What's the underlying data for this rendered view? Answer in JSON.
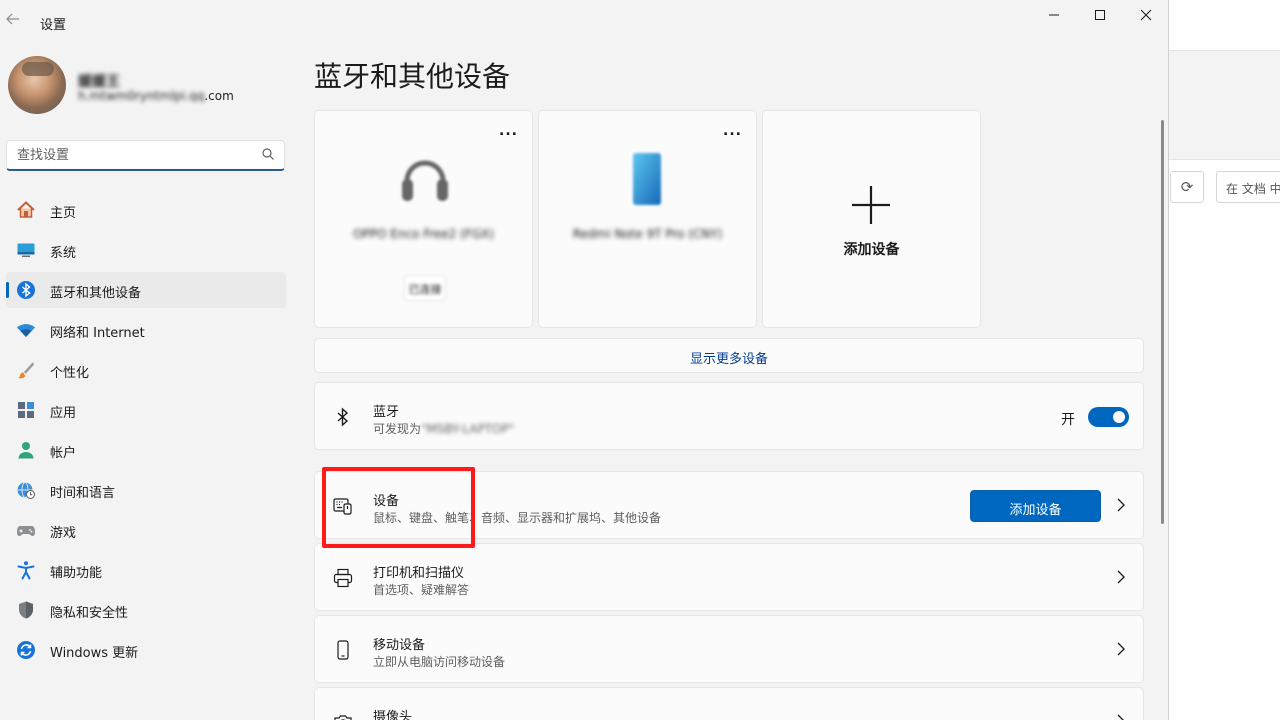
{
  "window": {
    "title": "设置"
  },
  "background_window": {
    "search_text": "在 文档 中"
  },
  "user": {
    "name": "媛媛王",
    "email_blurred": "h.mtwm0ryntmlpi.qq",
    "email_suffix": ".com"
  },
  "search": {
    "placeholder": "查找设置"
  },
  "nav": [
    {
      "label": "主页",
      "icon": "home-icon"
    },
    {
      "label": "系统",
      "icon": "monitor-icon"
    },
    {
      "label": "蓝牙和其他设备",
      "icon": "bluetooth-icon",
      "active": true
    },
    {
      "label": "网络和 Internet",
      "icon": "wifi-icon"
    },
    {
      "label": "个性化",
      "icon": "brush-icon"
    },
    {
      "label": "应用",
      "icon": "apps-icon"
    },
    {
      "label": "帐户",
      "icon": "person-icon"
    },
    {
      "label": "时间和语言",
      "icon": "globe-clock-icon"
    },
    {
      "label": "游戏",
      "icon": "gamepad-icon"
    },
    {
      "label": "辅助功能",
      "icon": "accessibility-icon"
    },
    {
      "label": "隐私和安全性",
      "icon": "shield-icon"
    },
    {
      "label": "Windows 更新",
      "icon": "update-icon"
    }
  ],
  "page": {
    "title": "蓝牙和其他设备"
  },
  "device_cards": [
    {
      "name": "OPPO Enco Free2 (FGX)",
      "status": "已连接",
      "icon": "headphones-icon",
      "more": "..."
    },
    {
      "name": "Redmi Note 9T Pro (CNY)",
      "icon": "phone-icon",
      "more": "..."
    },
    {
      "label": "添加设备",
      "icon": "plus-icon"
    }
  ],
  "show_more": "显示更多设备",
  "bluetooth": {
    "title": "蓝牙",
    "sub_prefix": "可发现为",
    "sub_blurred": "\"MSBY-LAPTOP\"",
    "toggle_label": "开",
    "on": true
  },
  "devices_row": {
    "title": "设备",
    "subtitle": "鼠标、键盘、触笔、音频、显示器和扩展坞、其他设备",
    "button": "添加设备"
  },
  "printers_row": {
    "title": "打印机和扫描仪",
    "subtitle": "首选项、疑难解答"
  },
  "mobile_row": {
    "title": "移动设备",
    "subtitle": "立即从电脑访问移动设备"
  },
  "camera_row": {
    "title": "摄像头"
  },
  "colors": {
    "accent": "#0067c0",
    "highlight": "#ff1a1a",
    "background": "#f3f3f3"
  }
}
